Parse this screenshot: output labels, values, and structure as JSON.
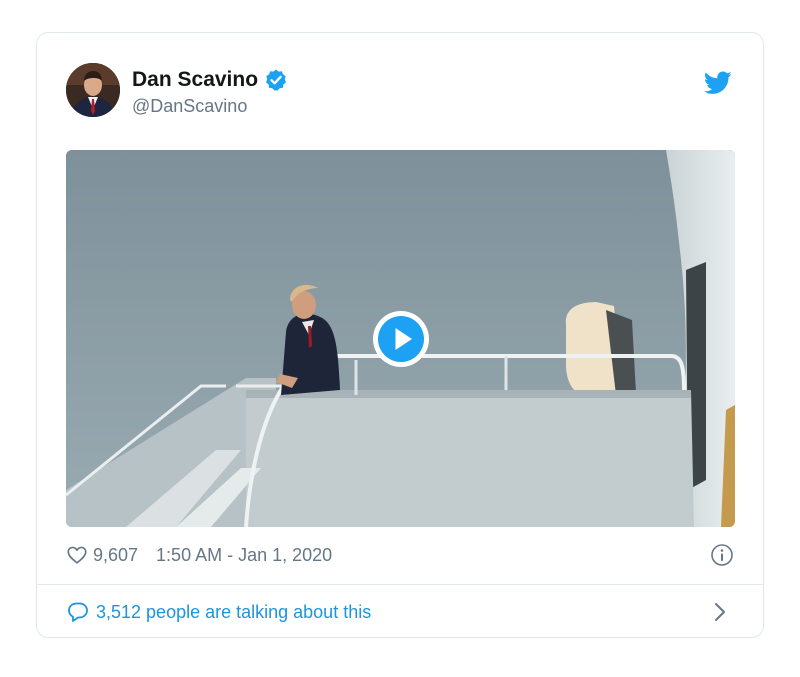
{
  "author": {
    "name": "Dan Scavino",
    "handle": "@DanScavino",
    "verified": true
  },
  "media": {
    "type": "video"
  },
  "meta": {
    "likes": "9,607",
    "timestamp": "1:50 AM - Jan 1, 2020"
  },
  "conversation": {
    "label": "3,512 people are talking about this"
  },
  "icons": {
    "brand": "twitter-bird-icon",
    "like": "heart-icon",
    "info": "info-icon",
    "reply": "comment-icon",
    "more": "chevron-right-icon",
    "play": "play-icon",
    "verified": "verified-badge-icon"
  },
  "colors": {
    "brand": "#1da1f2",
    "link": "#1b95e0",
    "muted": "#657786",
    "text": "#14171a",
    "border": "#e1e8ed"
  }
}
